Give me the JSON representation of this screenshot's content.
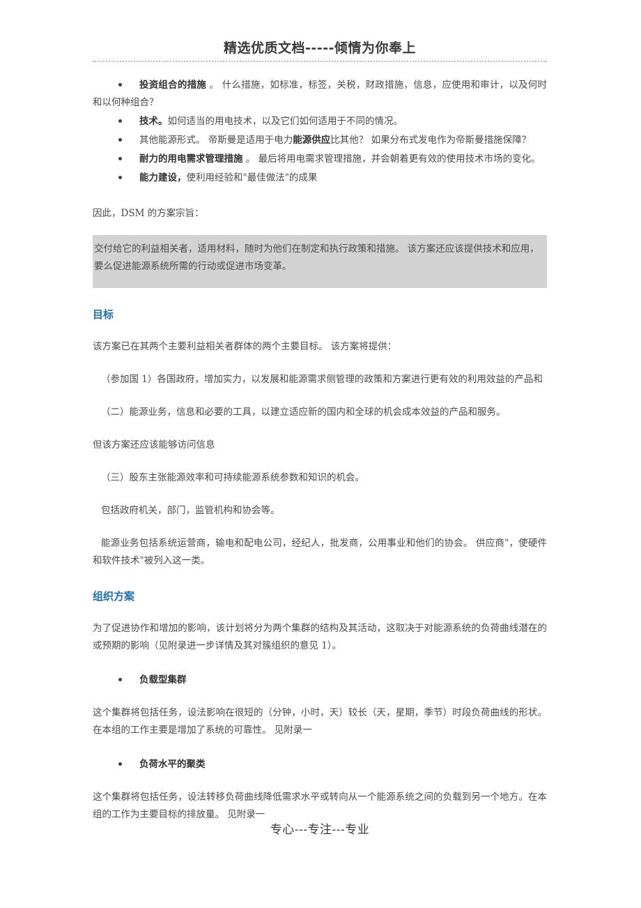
{
  "document": {
    "header_title": "精选优质文档-----倾情为你奉上",
    "footer_text": "专心---专注---专业",
    "accent_color": "#1f6fa8",
    "quote_background": "#d3d3d3",
    "body_color": "#4a4a4a"
  },
  "bullets": [
    {
      "lead": "投资组合的措施",
      "rest": " 。 什么措施，如标准，标签，关税，财政措施，信息，应使用和审计，以及何时和以何种组合？"
    },
    {
      "lead": "技术。",
      "rest": "如何适当的用电技术，以及它们如何适用于不同的情况。"
    },
    {
      "pre": "其他能源形式。 帝斯曼是适用于电力",
      "mid": "能源供应",
      "post": "比其他？ 如果分布式发电作为帝斯曼措施保障？"
    },
    {
      "lead": "耐力的用电需求管理措施",
      "rest": " 。 最后将用电需求管理措施，并会朝着更有效的使用技术市场的变化。"
    },
    {
      "lead": "能力建设，",
      "rest": "使利用经验和\"最佳做法\"的成果"
    }
  ],
  "intro": {
    "purpose_line": "因此，DSM 的方案宗旨："
  },
  "quote": {
    "line1": "交付给它的利益相关者，适用材料，随时为他们在制定和执行政策和措施。 该方案还应该提供技术和应用，",
    "line2": "要么促进能源系统所需的行动或促进市场变革。"
  },
  "objectives": {
    "heading": "目标",
    "lead": "该方案已在其两个主要利益相关者群体的两个主要目标。 该方案将提供：",
    "item1": "（参加国 1）各国政府，增加实力，以发展和能源需求侧管理的政策和方案进行更有效的利用效益的产品和",
    "item2": "（二）能源业务，信息和必要的工具，以建立适应新的国内和全球的机会成本效益的产品和服务。",
    "note": "但该方案还应该能够访问信息",
    "item3": "（三）股东主张能源效率和可持续能源系统参数和知识的机会。",
    "note2": "包括政府机关，部门，监管机构和协会等。",
    "note3": "能源业务包括系统运营商，输电和配电公司，经纪人，批发商，公用事业和他们的协会。 供应商\"，使硬件和软件技术\"被列入这一类。"
  },
  "organization": {
    "heading": "组织方案",
    "lead": "为了促进协作和增加的影响，该计划将分为两个集群的结构及其活动，这取决于对能源系统的负荷曲线潜在的或预期的影响（见附录进一步详情及其对簇组织的意见 1）。",
    "clusters": [
      {
        "title": "负载型集群",
        "body": "这个集群将包括任务，设法影响在很短的（分钟，小时，天）较长（天，星期，季节）时段负荷曲线的形状。 在本组的工作主要是增加了系统的可靠性。 见附录一"
      },
      {
        "title": "负荷水平的聚类",
        "body": "这个集群将包括任务，设法转移负荷曲线降低需求水平或转向从一个能源系统之间的负载到另一个地方。在本组的工作为主要目标的排放量。 见附录一"
      }
    ]
  }
}
